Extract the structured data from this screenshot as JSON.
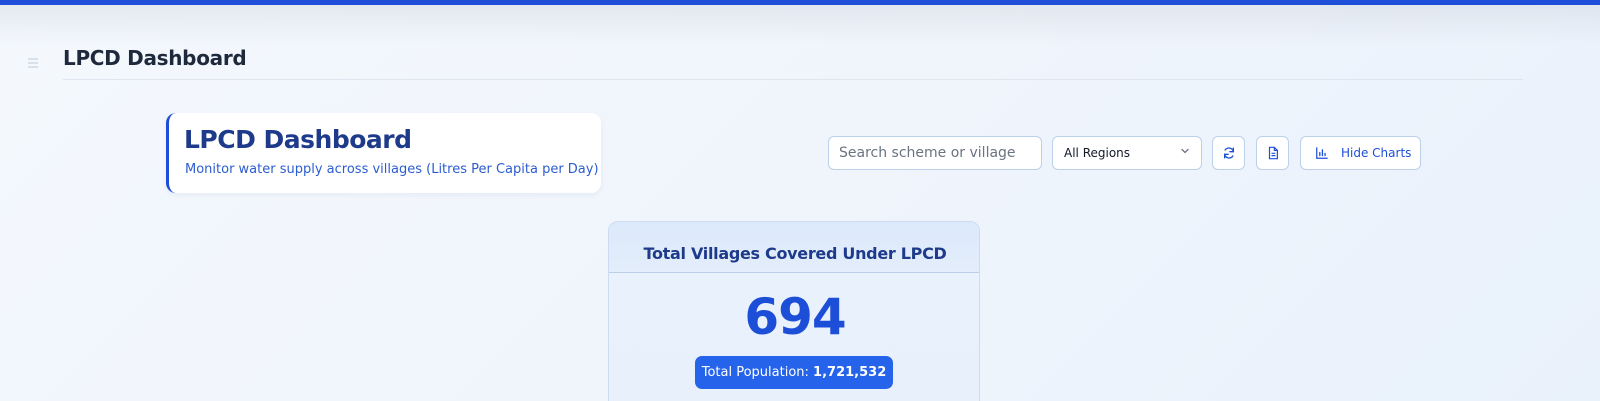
{
  "header": {
    "title": "LPCD Dashboard"
  },
  "hero": {
    "title": "LPCD Dashboard",
    "subtitle": "Monitor water supply across villages (Litres Per Capita per Day)"
  },
  "toolbar": {
    "search_placeholder": "Search scheme or village",
    "search_value": "",
    "region_selected": "All Regions",
    "hide_charts_label": "Hide Charts"
  },
  "stat": {
    "title": "Total Villages Covered Under LPCD",
    "villages_count": "694",
    "population_label": "Total Population:",
    "population_value": "1,721,532"
  },
  "colors": {
    "accent": "#1d4ed8",
    "top_bar": "#1f4fd8",
    "badge": "#2563eb",
    "title_text": "#1e3a8a"
  },
  "icons": {
    "menu": "menu-icon",
    "refresh": "refresh-icon",
    "report": "report-icon",
    "chart": "bar-chart-icon",
    "dropdown": "chevron-down-icon"
  }
}
